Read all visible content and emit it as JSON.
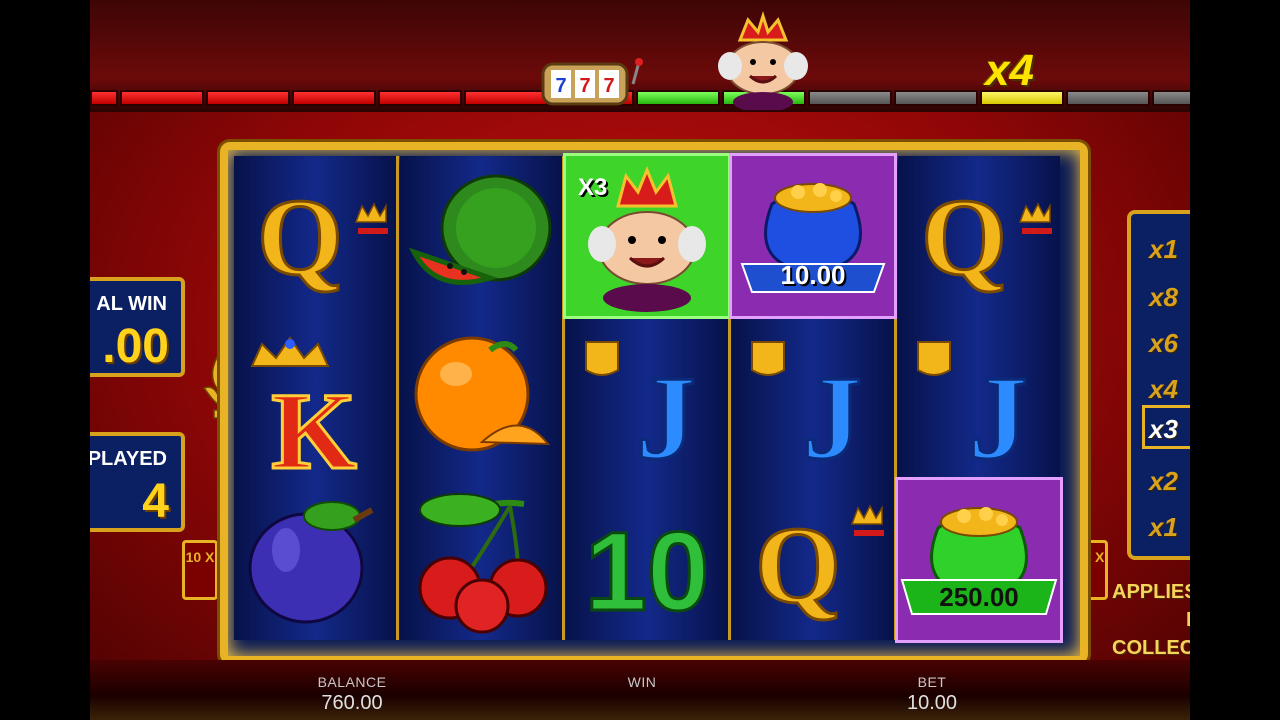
{
  "top_bar": {
    "multiplier": "x4",
    "segments": [
      "red",
      "red",
      "red",
      "red",
      "red",
      "red",
      "red-slot",
      "green",
      "green-king",
      "grey",
      "grey",
      "yellow",
      "grey",
      "grey"
    ]
  },
  "left_panels": {
    "total_win_label": "AL WIN",
    "total_win_value": ".00",
    "spins_label": "S PLAYED",
    "spins_value": "4"
  },
  "reels": [
    [
      "queen",
      "king",
      "plum"
    ],
    [
      "watermelon",
      "orange",
      "cherries"
    ],
    [
      "king-character",
      "jack",
      "ten"
    ],
    [
      "blue-money-bag",
      "jack",
      "queen"
    ],
    [
      "queen",
      "jack",
      "green-money-bag"
    ]
  ],
  "reel_values": {
    "king_multiplier": "X3",
    "blue_bag_value": "10.00",
    "green_bag_value": "250.00"
  },
  "side_multipliers": [
    "x1",
    "x8",
    "x6",
    "x4",
    "x3",
    "x2",
    "x1"
  ],
  "applies_text": [
    "APPLIES",
    "BA",
    "COLLECT"
  ],
  "side_badge": "10 X",
  "bottom_bar": {
    "balance_label": "BALANCE",
    "balance_value": "760.00",
    "win_label": "WIN",
    "win_value": "",
    "bet_label": "BET",
    "bet_value": "10.00"
  }
}
